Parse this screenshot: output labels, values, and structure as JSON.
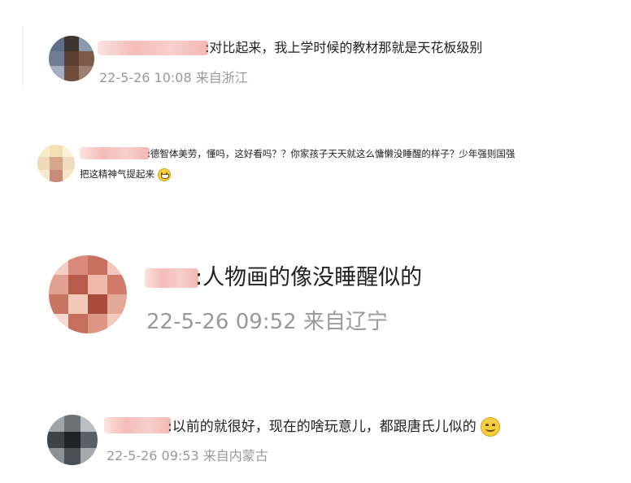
{
  "comments": [
    {
      "text": ":对比起来，我上学时候的教材那就是天花板级别",
      "time": "22-5-26 10:08",
      "location": "来自浙江"
    },
    {
      "text_line1": ":德智体美劳，懂吗，这好看吗？？你家孩子天天就这么慵懒没睡醒的样子？少年强则国强",
      "text_line2": "把这精神气提起来",
      "emoji": "grin-emoji"
    },
    {
      "text": ":人物画的像没睡醒似的",
      "time": "22-5-26 09:52",
      "location": "来自辽宁"
    },
    {
      "text": ":以前的就很好，现在的啥玩意儿，都跟唐氏儿似的",
      "emoji": "smile-emoji",
      "time": "22-5-26 09:53",
      "location": "来自内蒙古"
    }
  ],
  "colors": {
    "name_blur": "#f6c6c3",
    "meta_gray": "#999999",
    "text_dark": "#222222"
  }
}
